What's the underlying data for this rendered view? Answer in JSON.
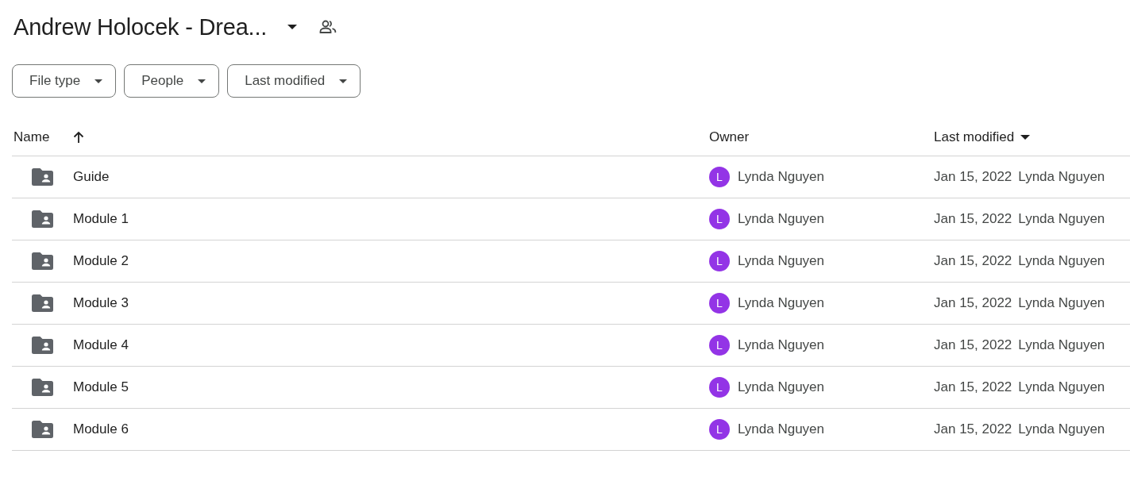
{
  "header": {
    "title": "Andrew Holocek - Drea..."
  },
  "filters": [
    {
      "label": "File type"
    },
    {
      "label": "People"
    },
    {
      "label": "Last modified"
    }
  ],
  "table": {
    "columns": [
      "Name",
      "Owner",
      "Last modified"
    ],
    "rows": [
      {
        "name": "Guide",
        "owner_initial": "L",
        "owner": "Lynda Nguyen",
        "modified": "Jan 15, 2022",
        "modified_by": "Lynda Nguyen"
      },
      {
        "name": "Module 1",
        "owner_initial": "L",
        "owner": "Lynda Nguyen",
        "modified": "Jan 15, 2022",
        "modified_by": "Lynda Nguyen"
      },
      {
        "name": "Module 2",
        "owner_initial": "L",
        "owner": "Lynda Nguyen",
        "modified": "Jan 15, 2022",
        "modified_by": "Lynda Nguyen"
      },
      {
        "name": "Module 3",
        "owner_initial": "L",
        "owner": "Lynda Nguyen",
        "modified": "Jan 15, 2022",
        "modified_by": "Lynda Nguyen"
      },
      {
        "name": "Module 4",
        "owner_initial": "L",
        "owner": "Lynda Nguyen",
        "modified": "Jan 15, 2022",
        "modified_by": "Lynda Nguyen"
      },
      {
        "name": "Module 5",
        "owner_initial": "L",
        "owner": "Lynda Nguyen",
        "modified": "Jan 15, 2022",
        "modified_by": "Lynda Nguyen"
      },
      {
        "name": "Module 6",
        "owner_initial": "L",
        "owner": "Lynda Nguyen",
        "modified": "Jan 15, 2022",
        "modified_by": "Lynda Nguyen"
      }
    ]
  }
}
